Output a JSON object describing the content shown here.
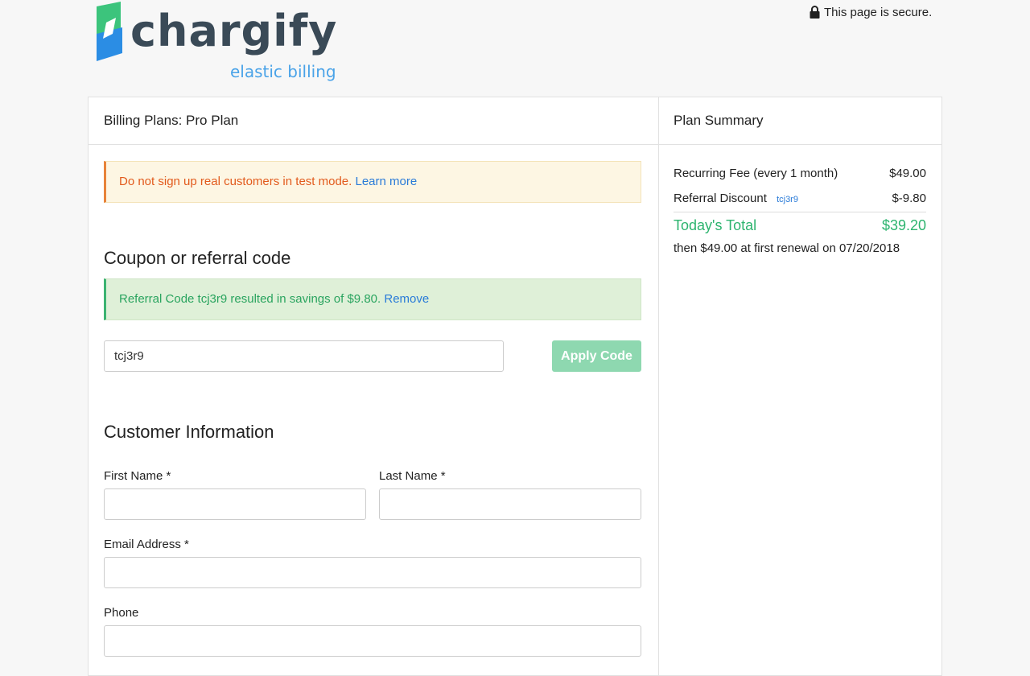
{
  "brand": {
    "name": "chargify",
    "tagline": "elastic billing",
    "colors": {
      "mark_top": "#3cc47c",
      "mark_bottom": "#2b8de4",
      "word": "#3a4a57",
      "tagline": "#4aa3e8"
    }
  },
  "header": {
    "secure_text": "This page is secure.",
    "secure_icon": "lock-icon"
  },
  "plan_panel": {
    "title": "Billing Plans: Pro Plan"
  },
  "test_alert": {
    "text": "Do not sign up real customers in test mode.",
    "link": "Learn more"
  },
  "coupon": {
    "title": "Coupon or referral code",
    "success_text": "Referral Code tcj3r9 resulted in savings of $9.80.",
    "remove_link": "Remove",
    "input_value": "tcj3r9",
    "apply_label": "Apply Code"
  },
  "customer": {
    "title": "Customer Information",
    "first_name_label": "First Name *",
    "last_name_label": "Last Name *",
    "email_label": "Email Address *",
    "phone_label": "Phone"
  },
  "summary": {
    "title": "Plan Summary",
    "recurring_label": "Recurring Fee (every 1 month)",
    "recurring_amount": "$49.00",
    "discount_label": "Referral Discount",
    "discount_code": "tcj3r9",
    "discount_amount": "$-9.80",
    "total_label": "Today's Total",
    "total_amount": "$39.20",
    "renewal_text": "then $49.00 at first renewal on 07/20/2018"
  }
}
